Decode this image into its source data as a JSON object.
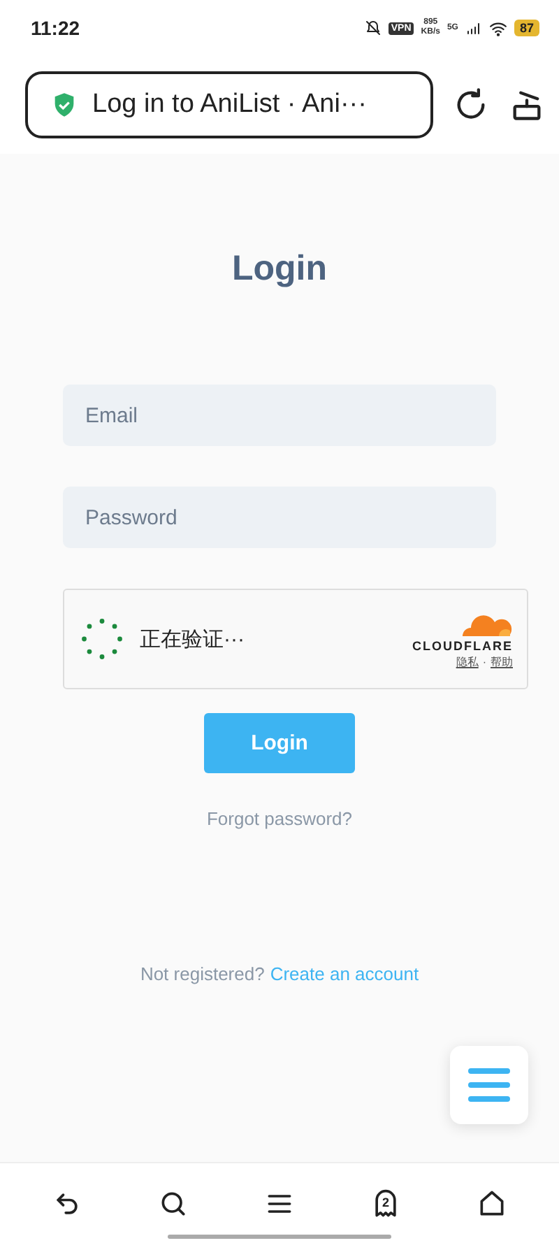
{
  "status_bar": {
    "time": "11:22",
    "vpn": "VPN",
    "speed_value": "895",
    "speed_unit": "KB/s",
    "network": "5G",
    "battery": "87"
  },
  "address_bar": {
    "title": "Log in to AniList · Ani···"
  },
  "login": {
    "title": "Login",
    "email": {
      "placeholder": "Email"
    },
    "password": {
      "placeholder": "Password"
    },
    "captcha": {
      "status": "正在验证···",
      "brand": "CLOUDFLARE",
      "links": [
        "隐私",
        "帮助"
      ],
      "separator": "·"
    },
    "submit": "Login",
    "forgot": "Forgot password?",
    "prompt": "Not registered?",
    "signup": "Create an account"
  },
  "bottom_nav": {
    "tab_count": "2"
  }
}
